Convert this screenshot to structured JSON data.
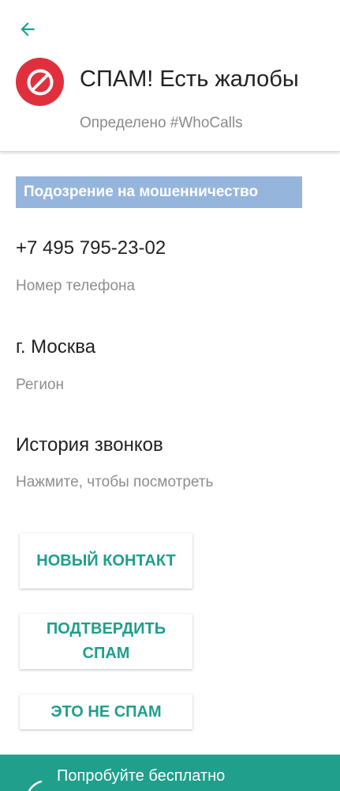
{
  "header": {
    "title": "СПАМ! Есть жалобы",
    "subtitle": "Определено #WhoCalls",
    "back_icon": "arrow-left-icon",
    "status_icon": "block-icon"
  },
  "badge": {
    "label": "Подозрение на мошенничество"
  },
  "phone": {
    "value": "+7 495 795-23-02",
    "label": "Номер телефона"
  },
  "region": {
    "value": "г. Москва",
    "label": "Регион"
  },
  "history": {
    "title": "История звонков",
    "hint": "Нажмите, чтобы посмотреть"
  },
  "buttons": {
    "new_contact": "НОВЫЙ КОНТАКТ",
    "confirm_spam": "ПОДТВЕРДИТЬ СПАМ",
    "not_spam": "ЭТО НЕ СПАМ"
  },
  "promo": {
    "text": "Попробуйте бесплатно",
    "icon": "rocket-icon"
  },
  "colors": {
    "accent": "#1f9f8c",
    "spam_red": "#e0303e",
    "badge_blue": "#96b5dd"
  }
}
